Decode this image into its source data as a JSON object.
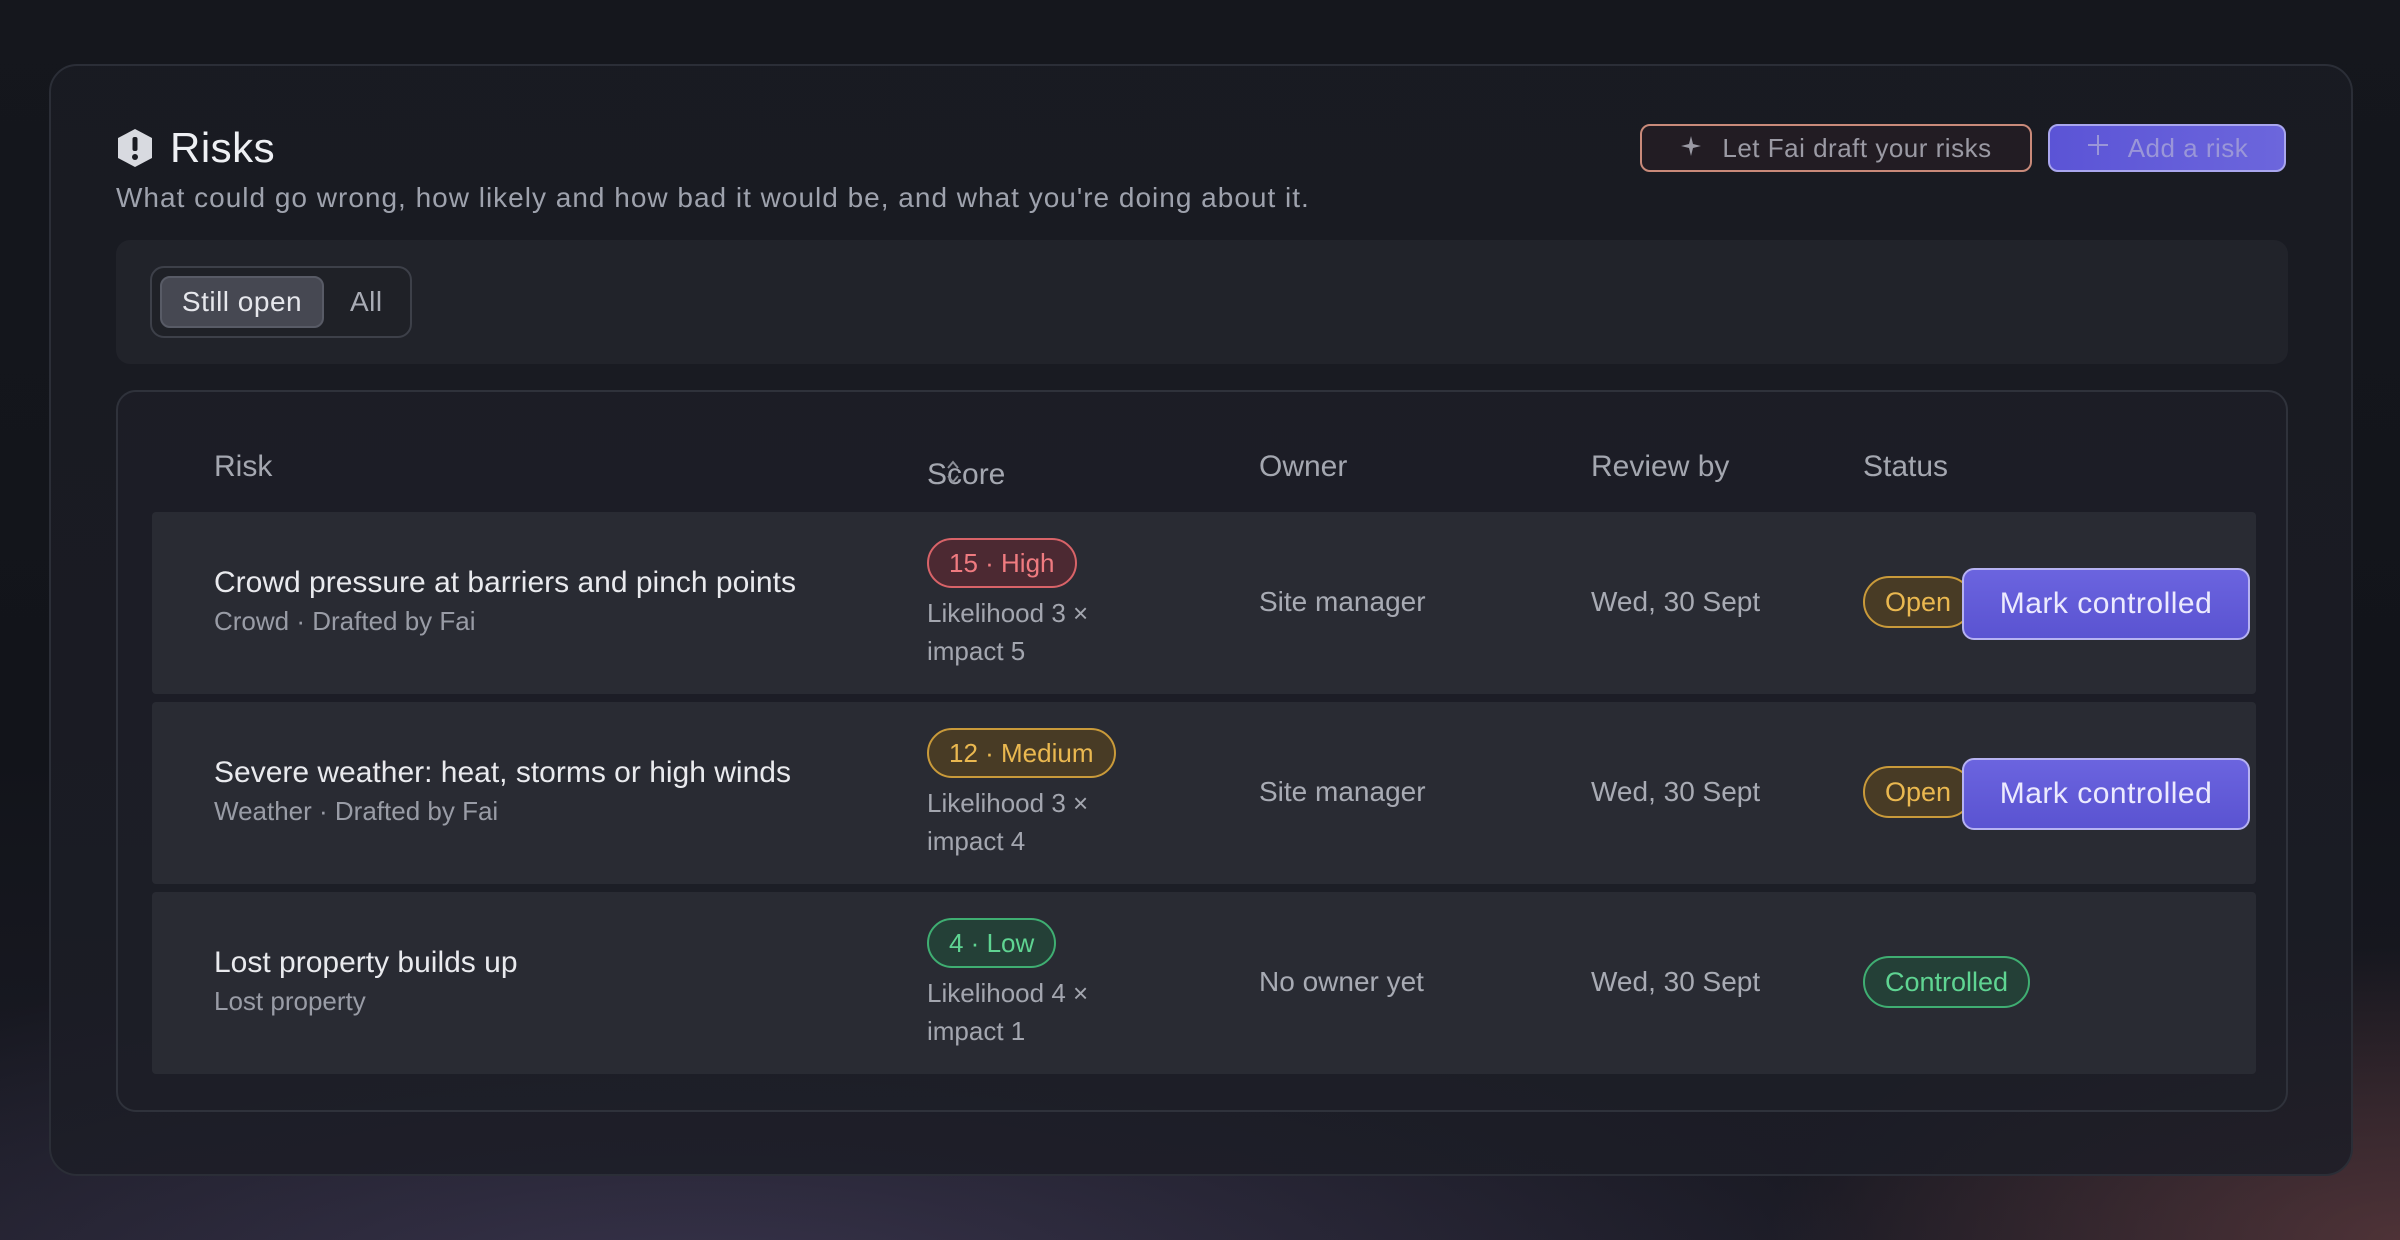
{
  "header": {
    "title": "Risks",
    "subtitle": "What could go wrong, how likely and how bad it would be, and what you're doing about it.",
    "fai_button": "Let Fai draft your risks",
    "add_button": "Add a risk"
  },
  "filter": {
    "options": [
      "Still open",
      "All"
    ],
    "selected": "Still open"
  },
  "table": {
    "columns": [
      "Risk",
      "Score",
      "Owner",
      "Review by",
      "Status"
    ],
    "rows": [
      {
        "name": "Crowd pressure at barriers and pinch points",
        "meta": "Crowd · Drafted by Fai",
        "score": "15 · High",
        "score_level": "high",
        "calc_line1": "Likelihood 3 ×",
        "calc_line2": "impact 5",
        "owner": "Site manager",
        "review": "Wed, 30 Sept",
        "status": "Open",
        "action": "Mark controlled"
      },
      {
        "name": "Severe weather: heat, storms or high winds",
        "meta": "Weather · Drafted by Fai",
        "score": "12 · Medium",
        "score_level": "medium",
        "calc_line1": "Likelihood 3 ×",
        "calc_line2": "impact 4",
        "owner": "Site manager",
        "review": "Wed, 30 Sept",
        "status": "Open",
        "action": "Mark controlled"
      },
      {
        "name": "Lost property builds up",
        "meta": "Lost property",
        "score": "4 · Low",
        "score_level": "low",
        "calc_line1": "Likelihood 4 ×",
        "calc_line2": "impact 1",
        "owner": "No owner yet",
        "review": "Wed, 30 Sept",
        "status": "Controlled",
        "action": ""
      }
    ]
  },
  "colors": {
    "accent": "#5b54d6",
    "high": "#ef7b80",
    "medium": "#eab850",
    "low": "#5fd492"
  },
  "icons": {
    "title": "shield-alert-icon",
    "fai": "sparkle-icon",
    "add": "plus-icon",
    "sort": "sort-icon"
  }
}
